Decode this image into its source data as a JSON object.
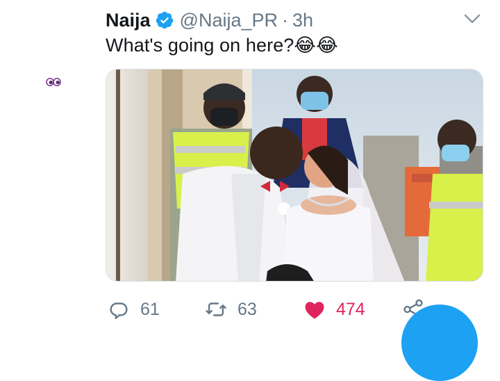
{
  "tweet": {
    "display_name": "Naija",
    "handle": "@Naija_PR",
    "separator": "·",
    "time": "3h",
    "text": "What's going on here?😂😂",
    "verified": true
  },
  "media": {
    "description_icon": "wedding-photo-image"
  },
  "actions": {
    "replies": "61",
    "retweets": "63",
    "likes": "474",
    "liked": true
  },
  "icons": {
    "reply": "comment-icon",
    "retweet": "retweet-icon",
    "like": "heart-icon",
    "share": "share-icon",
    "menu": "chevron-down-icon",
    "verified": "verified-badge-icon"
  },
  "colors": {
    "accent": "#1da1f2",
    "like": "#e0245e",
    "muted": "#657786",
    "text": "#14171a"
  }
}
